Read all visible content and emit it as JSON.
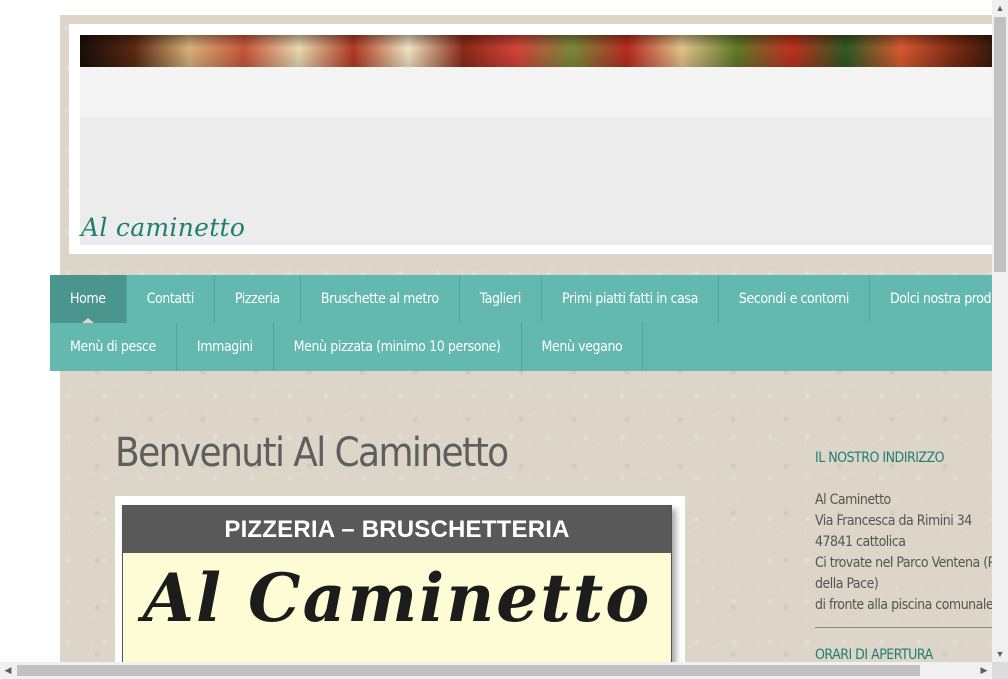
{
  "site": {
    "title": "Al caminetto"
  },
  "nav": {
    "row1": [
      {
        "label": "Home",
        "active": true
      },
      {
        "label": "Contatti"
      },
      {
        "label": "Pizzeria"
      },
      {
        "label": "Bruschette al metro"
      },
      {
        "label": "Taglieri"
      },
      {
        "label": "Primi piatti fatti in casa"
      },
      {
        "label": "Secondi e contorni"
      },
      {
        "label": "Dolci nostra produzione"
      }
    ],
    "row2": [
      {
        "label": "Menù di pesce"
      },
      {
        "label": "Immagini"
      },
      {
        "label": "Menù pizzata (minimo 10 persone)"
      },
      {
        "label": "Menù vegano"
      }
    ]
  },
  "main": {
    "heading": "Benvenuti Al Caminetto",
    "sign": {
      "header": "PIZZERIA – BRUSCHETTERIA",
      "name": "Al Caminetto"
    }
  },
  "sidebar": {
    "address_title": "IL NOSTRO INDIRIZZO",
    "address_lines": [
      "Al Caminetto",
      "Via Francesca da Rimini 34",
      "47841 cattolica",
      "Ci trovate nel Parco Ventena (Parco",
      "della Pace)",
      "di fronte alla piscina comunale"
    ],
    "hours_title": "ORARI DI APERTURA"
  },
  "colors": {
    "nav_bg": "#63b9b0",
    "nav_active": "#4a958d",
    "accent": "#1f7e74",
    "page_bg": "#dcd5c8"
  },
  "icons": {
    "scroll_up": "▲",
    "scroll_down": "▼",
    "scroll_left": "◀",
    "scroll_right": "▶"
  }
}
